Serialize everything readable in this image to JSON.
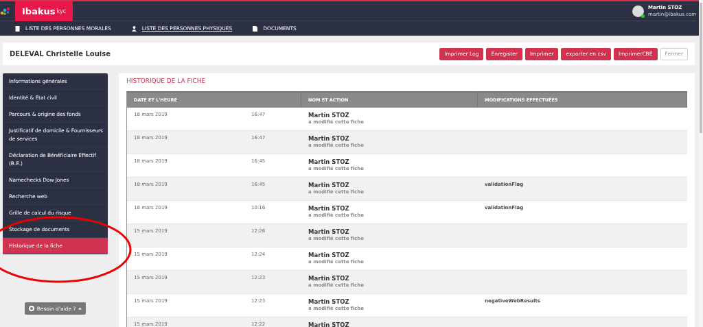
{
  "brand": {
    "name": "Ibakus",
    "suffix": "kyc"
  },
  "user": {
    "name": "Martin STOZ",
    "email": "martin@ibakus.com"
  },
  "nav": [
    {
      "label": "LISTE DES PERSONNES MORALES",
      "kind": "building",
      "selected": false
    },
    {
      "label": "LISTE DES PERSONNES PHYSIQUES",
      "kind": "person",
      "selected": true
    },
    {
      "label": "DOCUMENTS",
      "kind": "file",
      "selected": false
    }
  ],
  "record": {
    "title": "DELEVAL Christelle Louise"
  },
  "actions": [
    {
      "label": "Imprimer Log",
      "kind": "primary"
    },
    {
      "label": "Enregister",
      "kind": "primary"
    },
    {
      "label": "Imprimer",
      "kind": "primary"
    },
    {
      "label": "exporter en csv",
      "kind": "primary"
    },
    {
      "label": "ImprimerCBE",
      "kind": "primary"
    },
    {
      "label": "Fermer",
      "kind": "outline"
    }
  ],
  "sidebar": {
    "items": [
      {
        "label": "Informations générales",
        "selected": false
      },
      {
        "label": "Identité & Etat civil",
        "selected": false
      },
      {
        "label": "Parcours & origine des fonds",
        "selected": false
      },
      {
        "label": "Justificatif de domicile & Fournisseurs de services",
        "selected": false
      },
      {
        "label": "Déclaration de Bénéficiaire Effectif (B.E.)",
        "selected": false
      },
      {
        "label": "Namechecks Dow Jones",
        "selected": false
      },
      {
        "label": "Recherche web",
        "selected": false
      },
      {
        "label": "Grille de calcul du risque",
        "selected": false
      },
      {
        "label": "Stockage de documents",
        "selected": false
      },
      {
        "label": "Historique de la fiche",
        "selected": true
      }
    ]
  },
  "help": {
    "label": "Besoin d'aide ?"
  },
  "history": {
    "title": "HISTORIQUE DE LA FICHE",
    "columns": [
      "DATE ET L'HEURE",
      "NOM ET ACTION",
      "MODIFICATIONS EFFECTUÉES"
    ],
    "rows": [
      {
        "date": "18 mars 2019",
        "time": "16:47",
        "name": "Martin STOZ",
        "action": "a modifié cette fiche"
      },
      {
        "date": "18 mars 2019",
        "time": "16:47",
        "name": "Martin STOZ",
        "action": "a modifié cette fiche"
      },
      {
        "date": "18 mars 2019",
        "time": "16:45",
        "name": "Martin STOZ",
        "action": "a modifié cette fiche"
      },
      {
        "date": "18 mars 2019",
        "time": "16:45",
        "name": "Martin STOZ",
        "action": "a modifié cette fiche",
        "changes": "validationFlag"
      },
      {
        "date": "18 mars 2019",
        "time": "10:16",
        "name": "Martin STOZ",
        "action": "a modifié cette fiche",
        "changes": "validationFlag"
      },
      {
        "date": "15 mars 2019",
        "time": "12:26",
        "name": "Martin STOZ",
        "action": "a modifié cette fiche"
      },
      {
        "date": "15 mars 2019",
        "time": "12:24",
        "name": "Martin STOZ",
        "action": "a modifié cette fiche"
      },
      {
        "date": "15 mars 2019",
        "time": "12:23",
        "name": "Martin STOZ",
        "action": "a modifié cette fiche"
      },
      {
        "date": "15 mars 2019",
        "time": "12:23",
        "name": "Martin STOZ",
        "action": "a modifié cette fiche",
        "changes": "negativeWebResults"
      },
      {
        "date": "15 mars 2019",
        "time": "12:22",
        "name": "Martin STOZ"
      }
    ]
  }
}
